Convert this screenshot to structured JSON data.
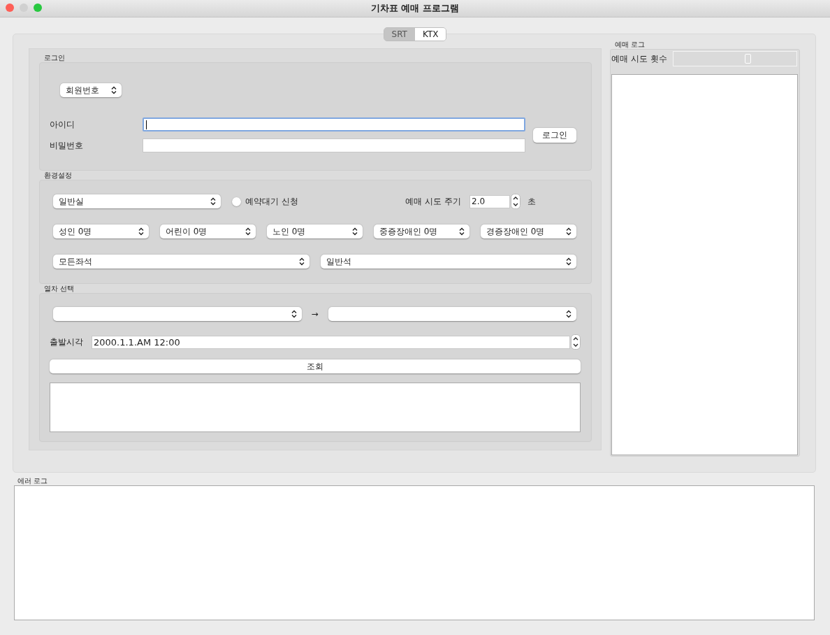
{
  "window": {
    "title": "기차표 예매 프로그램"
  },
  "tabs": [
    {
      "label": "SRT",
      "selected": false
    },
    {
      "label": "KTX",
      "selected": true
    }
  ],
  "login": {
    "title": "로그인",
    "member_type": "회원번호",
    "id_label": "아이디",
    "id_focused": true,
    "password_label": "비밀번호",
    "login_button": "로그인"
  },
  "settings": {
    "title": "환경설정",
    "car_class": "일반실",
    "waitlist": {
      "label": "예약대기 신청",
      "checked": false
    },
    "interval_label": "예매 시도 주기",
    "interval_value": "2.0",
    "interval_unit": "초",
    "passengers": [
      "성인 0명",
      "어린이 0명",
      "노인 0명",
      "중증장애인 0명",
      "경증장애인 0명"
    ],
    "seat_options": [
      "모든좌석",
      "일반석"
    ]
  },
  "train": {
    "title": "열차 선택",
    "arrow": "→",
    "departure_label": "출발시각",
    "departure_time": "2000.1.1.AM 12:00",
    "search_button": "조회"
  },
  "booking_log": {
    "title": "예매 로그",
    "attempts": {
      "label": "예매 시도 횟수",
      "level": 0.61
    }
  },
  "error_log": {
    "title": "에러 로그"
  }
}
